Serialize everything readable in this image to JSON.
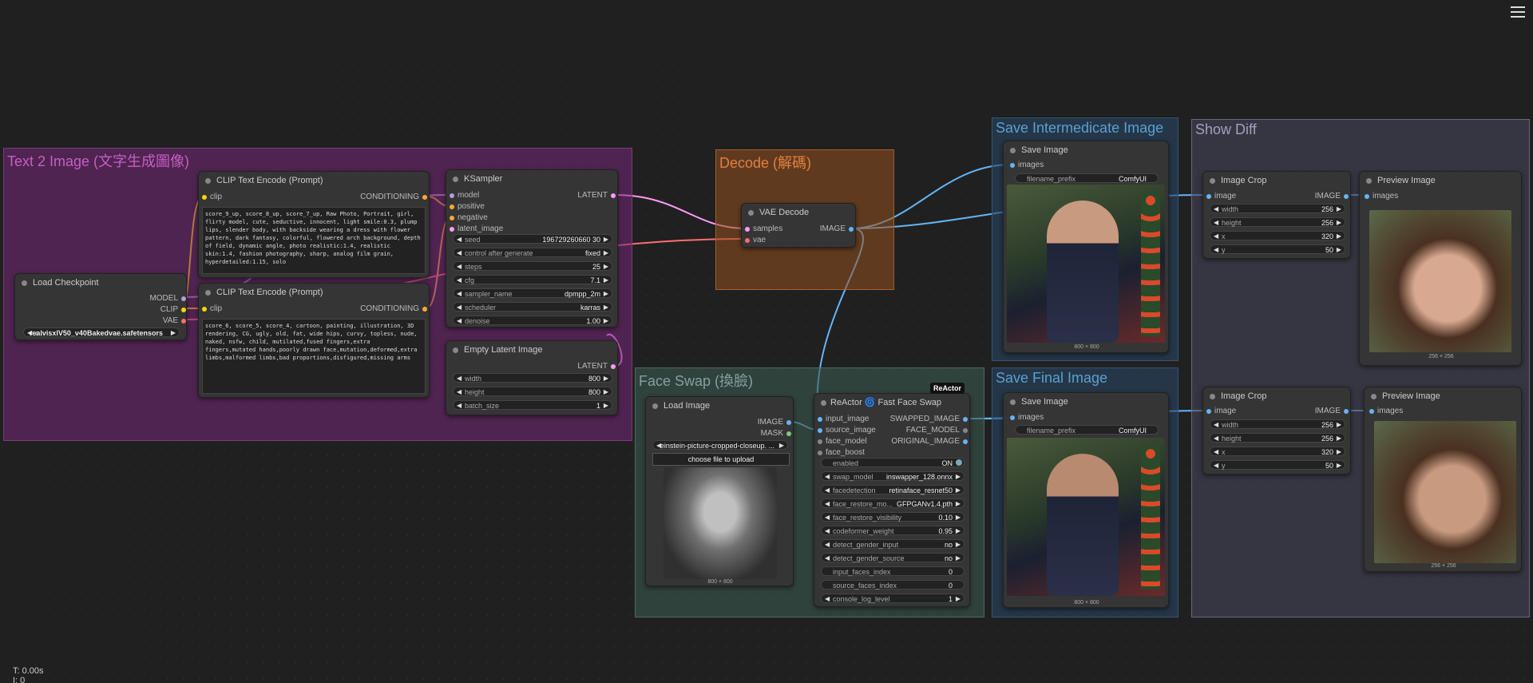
{
  "colors": {
    "clip": "#ffd500",
    "model": "#b39ddb",
    "conditioning": "#ffa931",
    "latent": "#ff9cf9",
    "vae": "#ff6e6e",
    "image": "#64b5f6",
    "mask": "#81c784"
  },
  "groups": {
    "text2image": "Text 2 Image (文字生成圖像)",
    "decode": "Decode (解碼)",
    "save_intermediate": "Save Intermedicate Image",
    "show_diff": "Show Diff",
    "face_swap": "Face Swap (換臉)",
    "save_final": "Save Final Image"
  },
  "load_checkpoint": {
    "title": "Load Checkpoint",
    "outputs": [
      "MODEL",
      "CLIP",
      "VAE"
    ],
    "ckpt_name": "realvisxlV50_v40Bakedvae.safetensors",
    "ckpt_prefix": "c..."
  },
  "clip_pos": {
    "title": "CLIP Text Encode (Prompt)",
    "input": "clip",
    "output": "CONDITIONING",
    "text": "score_9_up, score_8_up, score_7_up, Raw Photo, Portrait, girl, flirty model, cute, seductive, innocent, light smile:0.3, plump lips, slender body, with backside wearing a dress with flower pattern, dark fantasy, colorful, flowered arch background, depth of field, dynamic angle, photo realistic:1.4, realistic skin:1.4, fashion photography, sharp, analog film grain, hyperdetailed:1.15, solo"
  },
  "clip_neg": {
    "title": "CLIP Text Encode (Prompt)",
    "input": "clip",
    "output": "CONDITIONING",
    "text": "score_6, score_5, score_4, cartoon, painting, illustration, 3D rendering, CG, ugly, old, fat, wide hips, curvy, topless, nude, naked, nsfw, child, mutilated,fused fingers,extra fingers,mutated hands,poorly drawn face,mutation,deformed,extra limbs,malformed limbs,bad proportions,disfigured,missing arms"
  },
  "ksampler": {
    "title": "KSampler",
    "inputs": [
      "model",
      "positive",
      "negative",
      "latent_image"
    ],
    "output": "LATENT",
    "widgets": [
      [
        "seed",
        "196729260660 30"
      ],
      [
        "control after generate",
        "fixed"
      ],
      [
        "steps",
        "25"
      ],
      [
        "cfg",
        "7.1"
      ],
      [
        "sampler_name",
        "dpmpp_2m"
      ],
      [
        "scheduler",
        "karras"
      ],
      [
        "denoise",
        "1.00"
      ]
    ]
  },
  "empty_latent": {
    "title": "Empty Latent Image",
    "output": "LATENT",
    "widgets": [
      [
        "width",
        "800"
      ],
      [
        "height",
        "800"
      ],
      [
        "batch_size",
        "1"
      ]
    ]
  },
  "vae_decode": {
    "title": "VAE Decode",
    "inputs": [
      "samples",
      "vae"
    ],
    "output": "IMAGE"
  },
  "save_image_1": {
    "title": "Save Image",
    "input": "images",
    "filename_prefix_label": "filename_prefix",
    "filename_prefix": "ComfyUI",
    "caption": "800 × 800"
  },
  "save_image_2": {
    "title": "Save Image",
    "input": "images",
    "filename_prefix_label": "filename_prefix",
    "filename_prefix": "ComfyUI",
    "caption": "800 × 800"
  },
  "image_crop_1": {
    "title": "Image Crop",
    "input": "image",
    "output": "IMAGE",
    "widgets": [
      [
        "width",
        "256"
      ],
      [
        "height",
        "256"
      ],
      [
        "x",
        "320"
      ],
      [
        "y",
        "50"
      ]
    ]
  },
  "image_crop_2": {
    "title": "Image Crop",
    "input": "image",
    "output": "IMAGE",
    "widgets": [
      [
        "width",
        "256"
      ],
      [
        "height",
        "256"
      ],
      [
        "x",
        "320"
      ],
      [
        "y",
        "50"
      ]
    ]
  },
  "preview_1": {
    "title": "Preview Image",
    "input": "images",
    "caption": "256 × 256"
  },
  "preview_2": {
    "title": "Preview Image",
    "input": "images",
    "caption": "256 × 256"
  },
  "load_image": {
    "title": "Load Image",
    "outputs": [
      "IMAGE",
      "MASK"
    ],
    "image": "einstein-picture-cropped-closeup. ...",
    "upload": "choose file to upload",
    "caption": "800 × 800"
  },
  "reactor": {
    "title": "ReActor 🌀 Fast Face Swap",
    "badge": "ReActor",
    "inputs": [
      "input_image",
      "source_image",
      "face_model",
      "face_boost"
    ],
    "outputs": [
      "SWAPPED_IMAGE",
      "FACE_MODEL",
      "ORIGINAL_IMAGE"
    ],
    "enabled_label": "enabled",
    "enabled_value": "ON",
    "widgets": [
      [
        "swap_model",
        "inswapper_128.onnx"
      ],
      [
        "facedetection",
        "retinaface_resnet50"
      ],
      [
        "face_restore_mo...",
        "GFPGANv1.4.pth"
      ],
      [
        "face_restore_visibility",
        "0.10"
      ],
      [
        "codeformer_weight",
        "0.95"
      ],
      [
        "detect_gender_input",
        "no"
      ],
      [
        "detect_gender_source",
        "no"
      ],
      [
        "input_faces_index",
        "0"
      ],
      [
        "source_faces_index",
        "0"
      ],
      [
        "console_log_level",
        "1"
      ]
    ]
  },
  "status": {
    "time": "T: 0.00s",
    "line2": "I: 0"
  }
}
